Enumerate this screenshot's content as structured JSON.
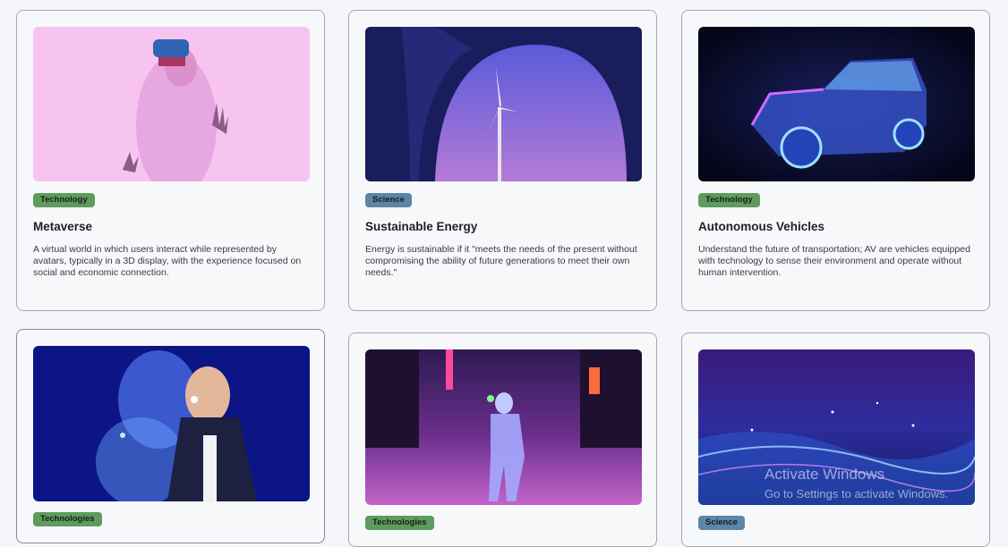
{
  "cards": [
    {
      "tag": "Technology",
      "title": "Metaverse",
      "description": "A virtual world in which users interact while represented by avatars, typically in a 3D display, with the experience focused on social and economic connection."
    },
    {
      "tag": "Science",
      "title": "Sustainable Energy",
      "description": "Energy is sustainable if it \"meets the needs of the present without compromising the ability of future generations to meet their own needs.\""
    },
    {
      "tag": "Technology",
      "title": "Autonomous Vehicles",
      "description": "Understand the future of transportation; AV are vehicles equipped with technology to sense their environment and operate without human intervention."
    },
    {
      "tag": "Technologies",
      "title": "",
      "description": ""
    },
    {
      "tag": "Technologies",
      "title": "",
      "description": ""
    },
    {
      "tag": "Science",
      "title": "",
      "description": ""
    }
  ],
  "watermark": {
    "line1": "Activate Windows",
    "line2": "Go to Settings to activate Windows."
  },
  "colors": {
    "technology_badge": "#5d9c5d",
    "science_badge": "#5b86a8",
    "card_border": "#a9a6bd"
  }
}
